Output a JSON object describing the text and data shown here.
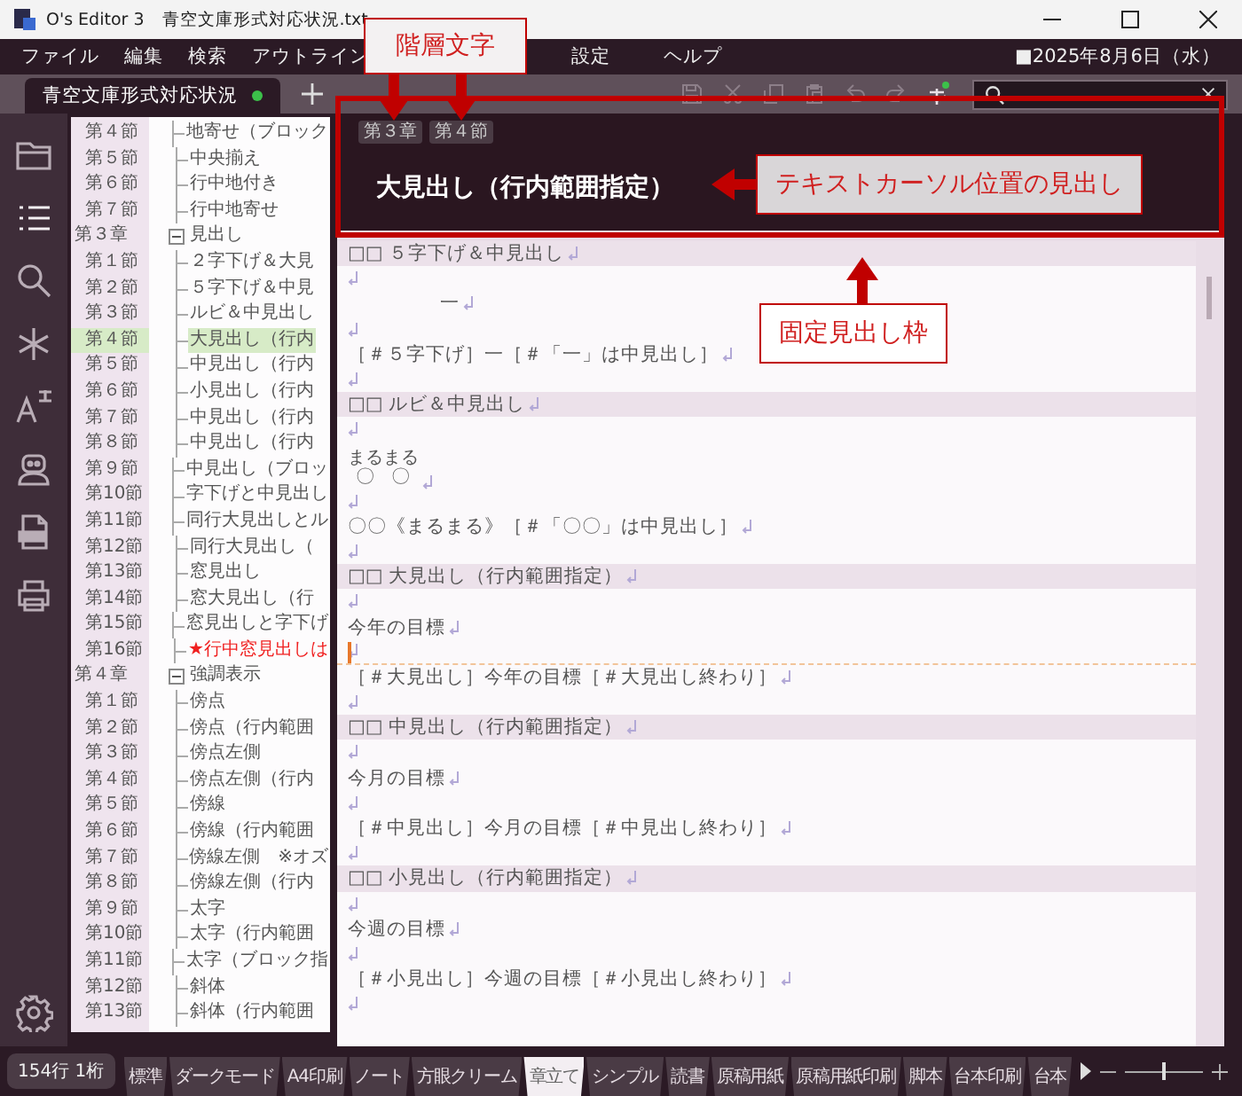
{
  "window": {
    "app_title": "O's Editor 3",
    "file_name": "青空文庫形式対応状況.txt"
  },
  "menu": [
    "ファイル",
    "編集",
    "検索",
    "アウトライン",
    "設定",
    "ヘルプ"
  ],
  "date": "■2025年8月6日（水）",
  "document_tab": {
    "label": "青空文庫形式対応状況",
    "selected": true,
    "modified": true
  },
  "side_rail": [
    {
      "kind": "folder",
      "selected": false
    },
    {
      "kind": "outline",
      "selected": true
    },
    {
      "kind": "search",
      "selected": false
    },
    {
      "kind": "asterisk",
      "selected": false
    },
    {
      "kind": "font",
      "selected": false
    },
    {
      "kind": "robot",
      "selected": false
    },
    {
      "kind": "pdf",
      "selected": false
    },
    {
      "kind": "print",
      "selected": false
    },
    {
      "kind": "settings",
      "selected": false
    }
  ],
  "outline": {
    "leading": [
      {
        "number": "第４節",
        "title": "地寄せ（ブロック",
        "selected": false,
        "starred": false
      },
      {
        "number": "第５節",
        "title": "中央揃え",
        "selected": false,
        "starred": false
      },
      {
        "number": "第６節",
        "title": "行中地付き",
        "selected": false,
        "starred": false
      },
      {
        "number": "第７節",
        "title": "行中地寄せ",
        "selected": false,
        "starred": false
      }
    ],
    "groups": [
      {
        "number": "第３章",
        "title": "見出し",
        "expanded": true,
        "selected": false,
        "children": [
          {
            "number": "第１節",
            "title": "２字下げ＆大見",
            "selected": false,
            "starred": false
          },
          {
            "number": "第２節",
            "title": "５字下げ＆中見",
            "selected": false,
            "starred": false
          },
          {
            "number": "第３節",
            "title": "ルビ＆中見出し",
            "selected": false,
            "starred": false
          },
          {
            "number": "第４節",
            "title": "大見出し（行内",
            "selected": true,
            "starred": false
          },
          {
            "number": "第５節",
            "title": "中見出し（行内",
            "selected": false,
            "starred": false
          },
          {
            "number": "第６節",
            "title": "小見出し（行内",
            "selected": false,
            "starred": false
          },
          {
            "number": "第７節",
            "title": "中見出し（行内",
            "selected": false,
            "starred": false
          },
          {
            "number": "第８節",
            "title": "中見出し（行内",
            "selected": false,
            "starred": false
          },
          {
            "number": "第９節",
            "title": "中見出し（ブロッ",
            "selected": false,
            "starred": false
          },
          {
            "number": "第10節",
            "title": "字下げと中見出し",
            "selected": false,
            "starred": false
          },
          {
            "number": "第11節",
            "title": "同行大見出しとル",
            "selected": false,
            "starred": false
          },
          {
            "number": "第12節",
            "title": "同行大見出し（",
            "selected": false,
            "starred": false
          },
          {
            "number": "第13節",
            "title": "窓見出し",
            "selected": false,
            "starred": false
          },
          {
            "number": "第14節",
            "title": "窓大見出し（行",
            "selected": false,
            "starred": false
          },
          {
            "number": "第15節",
            "title": "窓見出しと字下げ",
            "selected": false,
            "starred": false
          },
          {
            "number": "第16節",
            "title": "★行中窓見出しは",
            "selected": false,
            "starred": true
          }
        ]
      },
      {
        "number": "第４章",
        "title": "強調表示",
        "expanded": true,
        "selected": false,
        "children": [
          {
            "number": "第１節",
            "title": "傍点",
            "selected": false,
            "starred": false
          },
          {
            "number": "第２節",
            "title": "傍点（行内範囲",
            "selected": false,
            "starred": false
          },
          {
            "number": "第３節",
            "title": "傍点左側",
            "selected": false,
            "starred": false
          },
          {
            "number": "第４節",
            "title": "傍点左側（行内",
            "selected": false,
            "starred": false
          },
          {
            "number": "第５節",
            "title": "傍線",
            "selected": false,
            "starred": false
          },
          {
            "number": "第６節",
            "title": "傍線（行内範囲",
            "selected": false,
            "starred": false
          },
          {
            "number": "第７節",
            "title": "傍線左側　※オズ",
            "selected": false,
            "starred": false
          },
          {
            "number": "第８節",
            "title": "傍線左側（行内",
            "selected": false,
            "starred": false
          },
          {
            "number": "第９節",
            "title": "太字",
            "selected": false,
            "starred": false
          },
          {
            "number": "第10節",
            "title": "太字（行内範囲",
            "selected": false,
            "starred": false
          },
          {
            "number": "第11節",
            "title": "太字（ブロック指",
            "selected": false,
            "starred": false
          },
          {
            "number": "第12節",
            "title": "斜体",
            "selected": false,
            "starred": false
          },
          {
            "number": "第13節",
            "title": "斜体（行内範囲",
            "selected": false,
            "starred": false
          }
        ]
      }
    ]
  },
  "fixed_heading": {
    "levels": [
      "第３章",
      "第４節"
    ],
    "title": "大見出し（行内範囲指定）"
  },
  "document": {
    "sections": [
      {
        "heading": "□□ ５字下げ＆中見出し",
        "lines": [
          {
            "kind": "blank",
            "cursor": false
          },
          {
            "kind": "indented",
            "text": "一",
            "cursor": false
          },
          {
            "kind": "blank",
            "cursor": false
          },
          {
            "kind": "text",
            "text": "［＃５字下げ］一［＃「一」は中見出し］",
            "cursor": false
          },
          {
            "kind": "blank",
            "cursor": false
          }
        ]
      },
      {
        "heading": "□□ ルビ＆中見出し",
        "lines": [
          {
            "kind": "blank",
            "cursor": false
          },
          {
            "kind": "ruby",
            "text": "〇〇",
            "ruby": "まるまる",
            "cursor": false
          },
          {
            "kind": "blank",
            "cursor": false
          },
          {
            "kind": "text",
            "text": "〇〇《まるまる》［＃「〇〇」は中見出し］",
            "cursor": false
          },
          {
            "kind": "blank",
            "cursor": false
          }
        ]
      },
      {
        "heading": "□□ 大見出し（行内範囲指定）",
        "lines": [
          {
            "kind": "blank",
            "cursor": false
          },
          {
            "kind": "text",
            "text": "今年の目標",
            "cursor": false
          },
          {
            "kind": "blank",
            "cursor": true
          },
          {
            "kind": "text",
            "text": "［＃大見出し］今年の目標［＃大見出し終わり］",
            "cursor": false
          },
          {
            "kind": "blank",
            "cursor": false
          }
        ]
      },
      {
        "heading": "□□ 中見出し（行内範囲指定）",
        "lines": [
          {
            "kind": "blank",
            "cursor": false
          },
          {
            "kind": "text",
            "text": "今月の目標",
            "cursor": false
          },
          {
            "kind": "blank",
            "cursor": false
          },
          {
            "kind": "text",
            "text": "［＃中見出し］今月の目標［＃中見出し終わり］",
            "cursor": false
          },
          {
            "kind": "blank",
            "cursor": false
          }
        ]
      },
      {
        "heading": "□□ 小見出し（行内範囲指定）",
        "lines": [
          {
            "kind": "blank",
            "cursor": false
          },
          {
            "kind": "text",
            "text": "今週の目標",
            "cursor": false
          },
          {
            "kind": "blank",
            "cursor": false
          },
          {
            "kind": "text",
            "text": "［＃小見出し］今週の目標［＃小見出し終わり］",
            "cursor": false
          },
          {
            "kind": "blank",
            "cursor": false
          }
        ]
      }
    ]
  },
  "status": {
    "position": "154行 1桁"
  },
  "themes": [
    {
      "label": "標準",
      "selected": false
    },
    {
      "label": "ダークモード",
      "selected": false
    },
    {
      "label": "A4印刷",
      "selected": false
    },
    {
      "label": "ノート",
      "selected": false
    },
    {
      "label": "方眼クリーム",
      "selected": false
    },
    {
      "label": "章立て",
      "selected": true
    },
    {
      "label": "シンプル",
      "selected": false
    },
    {
      "label": "読書",
      "selected": false
    },
    {
      "label": "原稿用紙",
      "selected": false
    },
    {
      "label": "原稿用紙印刷",
      "selected": false
    },
    {
      "label": "脚本",
      "selected": false
    },
    {
      "label": "台本印刷",
      "selected": false
    },
    {
      "label": "台本",
      "selected": false
    }
  ],
  "zoom": {
    "level": 0.5
  },
  "annotations": [
    {
      "kind": "hierarchy",
      "text": "階層文字"
    },
    {
      "kind": "cursor_heading",
      "text": "テキストカーソル位置の見出し"
    },
    {
      "kind": "frame",
      "text": "固定見出し枠"
    }
  ]
}
